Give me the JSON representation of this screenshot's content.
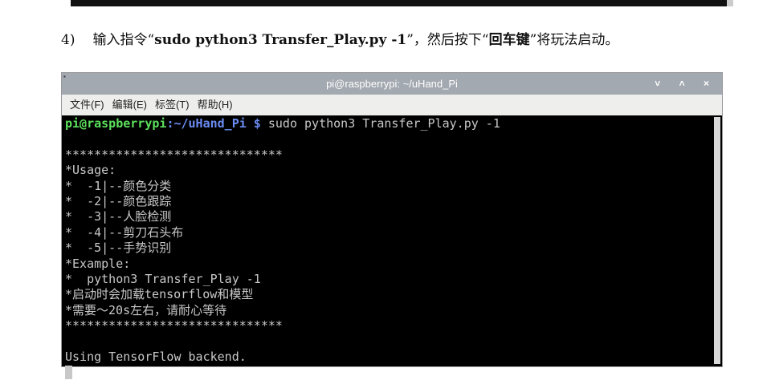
{
  "instruction": {
    "number": "4)",
    "pre": "输入指令“",
    "cmd": "sudo python3 Transfer_Play.py -1",
    "mid": "”，然后按下“",
    "key": "回车键",
    "post": "”将玩法启动。"
  },
  "window": {
    "title": "pi@raspberrypi: ~/uHand_Pi",
    "controls": "˅ ˄ ×"
  },
  "menu": [
    "文件(F)",
    "编辑(E)",
    "标签(T)",
    "帮助(H)"
  ],
  "terminal": {
    "prompt_user": "pi@raspberrypi",
    "prompt_path": ":~/uHand_Pi $",
    "command": " sudo python3 Transfer_Play.py -1",
    "lines": [
      "",
      "******************************",
      "*Usage:",
      "*  -1|--颜色分类",
      "*  -2|--颜色跟踪",
      "*  -3|--人脸检测",
      "*  -4|--剪刀石头布",
      "*  -5|--手势识别",
      "*Example:",
      "*  python3 Transfer_Play -1",
      "*启动时会加载tensorflow和模型",
      "*需要～20s左右，请耐心等待",
      "******************************",
      "",
      "Using TensorFlow backend."
    ]
  }
}
